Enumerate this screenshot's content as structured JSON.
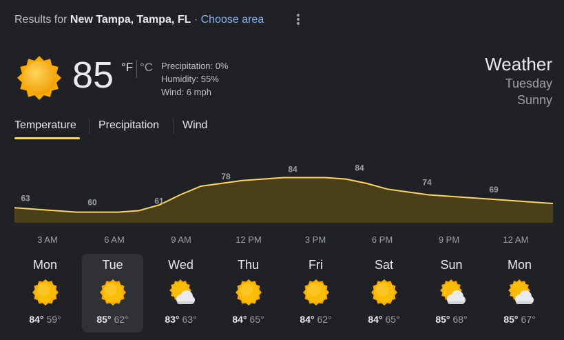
{
  "header": {
    "results_prefix": "Results for",
    "location": "New Tampa, Tampa, FL",
    "separator": "·",
    "choose_area": "Choose area",
    "more_icon": "more-vert-icon"
  },
  "current": {
    "icon": "sunny-icon",
    "temperature": "85",
    "unit_f": "°F",
    "unit_c": "°C",
    "precipitation": "Precipitation: 0%",
    "humidity": "Humidity: 55%",
    "wind": "Wind: 6 mph",
    "title": "Weather",
    "day": "Tuesday",
    "condition": "Sunny"
  },
  "tabs": [
    {
      "label": "Temperature",
      "selected": true
    },
    {
      "label": "Precipitation",
      "selected": false
    },
    {
      "label": "Wind",
      "selected": false
    }
  ],
  "colors": {
    "accent": "#fdd663",
    "background": "#202124",
    "chart_fill": "#4a3f19",
    "sun": "#f9ab00"
  },
  "chart_data": {
    "type": "area",
    "x_labels": [
      "3 AM",
      "6 AM",
      "9 AM",
      "12 PM",
      "3 PM",
      "6 PM",
      "9 PM",
      "12 AM"
    ],
    "labeled_points": [
      {
        "x": "3 AM",
        "y": 63
      },
      {
        "x": "6 AM",
        "y": 60
      },
      {
        "x": "9 AM",
        "y": 61
      },
      {
        "x": "12 PM",
        "y": 78
      },
      {
        "x": "3 PM",
        "y": 84
      },
      {
        "x": "6 PM",
        "y": 84
      },
      {
        "x": "9 PM",
        "y": 74
      },
      {
        "x": "12 AM",
        "y": 69
      }
    ],
    "series": [
      {
        "values": [
          63,
          62,
          61,
          60,
          60,
          60,
          61,
          65,
          72,
          78,
          80,
          82,
          83,
          84,
          84,
          84,
          83,
          80,
          76,
          74,
          72,
          71,
          70,
          69,
          68,
          67,
          66
        ]
      }
    ],
    "ylim": [
      55,
      90
    ],
    "grid": false
  },
  "forecast": [
    {
      "day": "Mon",
      "icon": "sunny-icon",
      "high": "84°",
      "low": "59°",
      "selected": false
    },
    {
      "day": "Tue",
      "icon": "sunny-icon",
      "high": "85°",
      "low": "62°",
      "selected": true
    },
    {
      "day": "Wed",
      "icon": "partly-cloudy-icon",
      "high": "83°",
      "low": "63°",
      "selected": false
    },
    {
      "day": "Thu",
      "icon": "sunny-icon",
      "high": "84°",
      "low": "65°",
      "selected": false
    },
    {
      "day": "Fri",
      "icon": "sunny-icon",
      "high": "84°",
      "low": "62°",
      "selected": false
    },
    {
      "day": "Sat",
      "icon": "sunny-icon",
      "high": "84°",
      "low": "65°",
      "selected": false
    },
    {
      "day": "Sun",
      "icon": "partly-cloudy-icon",
      "high": "85°",
      "low": "68°",
      "selected": false
    },
    {
      "day": "Mon",
      "icon": "partly-cloudy-icon",
      "high": "85°",
      "low": "67°",
      "selected": false
    }
  ]
}
